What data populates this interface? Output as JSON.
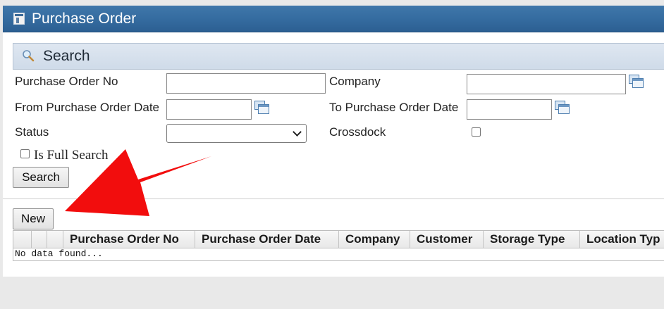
{
  "window": {
    "title": "Purchase Order",
    "title_icon": "table-icon"
  },
  "search": {
    "header": "Search",
    "header_icon": "magnifier-icon",
    "fields": {
      "po_no": {
        "label": "Purchase Order No",
        "value": ""
      },
      "company": {
        "label": "Company",
        "value": ""
      },
      "from_date": {
        "label": "From Purchase Order Date",
        "value": ""
      },
      "to_date": {
        "label": "To Purchase Order Date",
        "value": ""
      },
      "status": {
        "label": "Status",
        "value": ""
      },
      "crossdock": {
        "label": "Crossdock",
        "checked": false
      }
    },
    "full_search": {
      "label": "Is Full Search",
      "checked": false
    },
    "button": "Search"
  },
  "actions": {
    "new": "New"
  },
  "grid": {
    "columns": [
      "",
      "",
      "",
      "Purchase Order No",
      "Purchase Order Date",
      "Company",
      "Customer",
      "Storage Type",
      "Location Typ"
    ],
    "empty_message": "No data found..."
  },
  "annotation": {
    "arrow_color": "#f20d0d"
  },
  "colors": {
    "titlebar": "#356ca0",
    "search_header": "#d6e0ec"
  }
}
